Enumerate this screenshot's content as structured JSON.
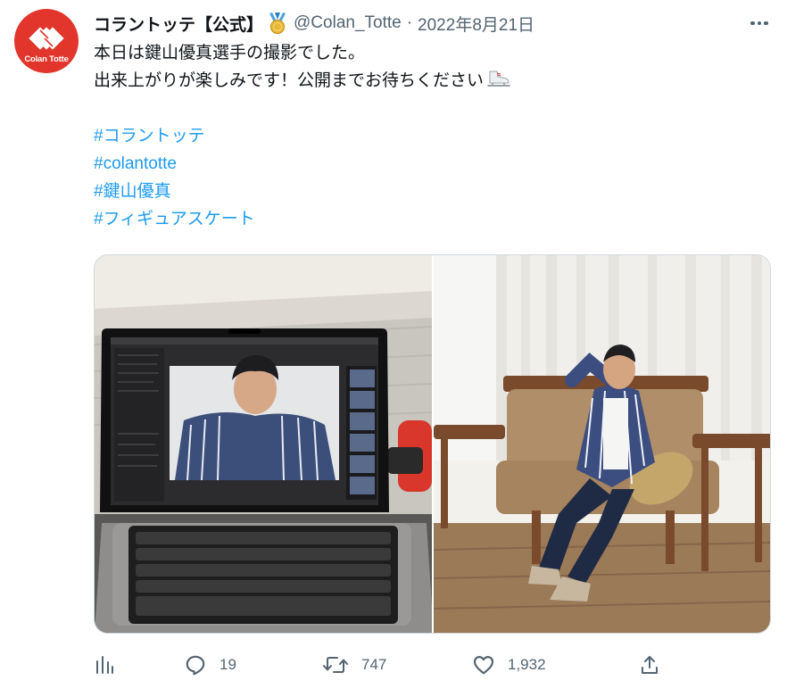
{
  "tweet": {
    "author": {
      "display_name": "コラントッテ【公式】",
      "handle": "@Colan_Totte",
      "verified_badge_icon": "gold-medal-icon",
      "avatar": {
        "brand_text": "Colan Totte",
        "background": "#e2352b"
      }
    },
    "separator": "·",
    "date": "2022年8月21日",
    "text_lines": [
      "本日は鍵山優真選手の撮影でした。",
      "出来上がりが楽しみです！公開までお待ちください"
    ],
    "emoji": "skate-icon",
    "hashtags": [
      "#コラントッテ",
      "#colantotte",
      "#鍵山優真",
      "#フィギュアスケート"
    ],
    "media": [
      {
        "name": "photo-laptop-editing",
        "icon": "laptop-photo"
      },
      {
        "name": "photo-athlete-on-sofa",
        "icon": "person-on-sofa-photo"
      }
    ],
    "actions": {
      "analytics": {
        "icon": "analytics-icon",
        "count": ""
      },
      "reply": {
        "icon": "reply-icon",
        "count": "19"
      },
      "retweet": {
        "icon": "retweet-icon",
        "count": "747"
      },
      "like": {
        "icon": "like-icon",
        "count": "1,932"
      },
      "share": {
        "icon": "share-icon",
        "count": ""
      }
    },
    "more_icon": "more-icon"
  },
  "colors": {
    "text": "#0f1419",
    "secondary": "#536471",
    "link": "#1d9bf0",
    "border": "#cfd9de",
    "brand_red": "#e2352b"
  }
}
